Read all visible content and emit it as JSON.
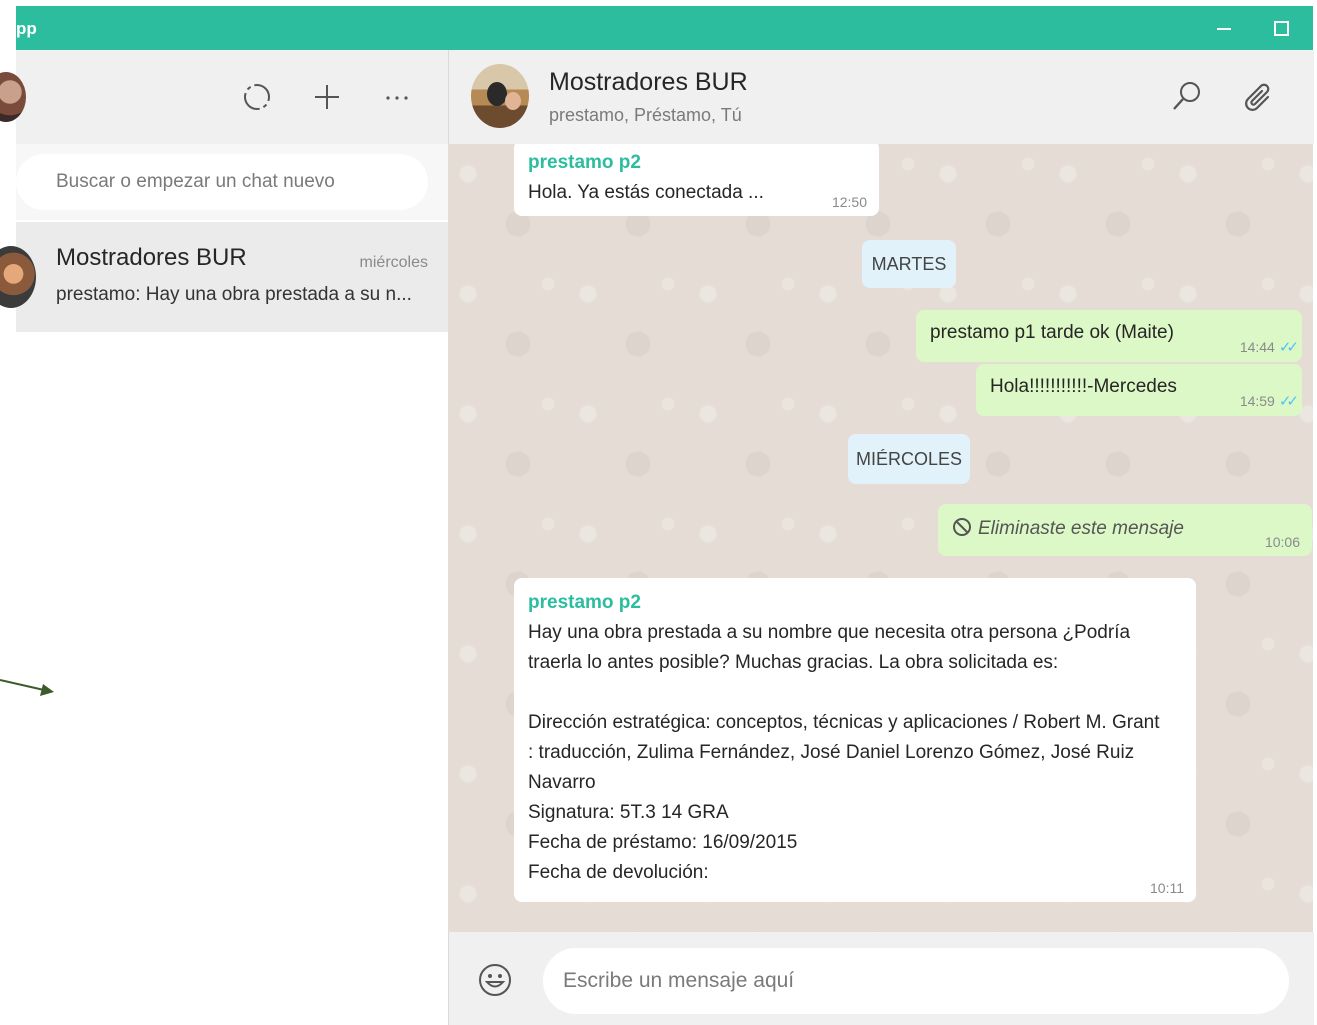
{
  "window": {
    "title": "pp",
    "accent_color": "#2bbd9e"
  },
  "sidebar": {
    "header_icons": [
      "status-icon",
      "new-chat-icon",
      "menu-icon"
    ],
    "search_placeholder": "Buscar o empezar un chat nuevo",
    "chats": [
      {
        "name": "Mostradores BUR",
        "time": "miércoles",
        "preview": "prestamo: Hay una obra prestada a su n..."
      }
    ]
  },
  "chat": {
    "name": "Mostradores BUR",
    "members": "prestamo, Préstamo, Tú",
    "header_icons": [
      "search-icon",
      "attach-icon"
    ],
    "messages": [
      {
        "type": "in",
        "sender": "prestamo p2",
        "text": "Hola. Ya estás conectada ...",
        "time": "12:50"
      },
      {
        "type": "date",
        "text": "MARTES"
      },
      {
        "type": "out",
        "text": "prestamo p1 tarde ok (Maite)",
        "time": "14:44",
        "read": true
      },
      {
        "type": "out",
        "text": "Hola!!!!!!!!!!!-Mercedes",
        "time": "14:59",
        "read": true
      },
      {
        "type": "date",
        "text": "MIÉRCOLES"
      },
      {
        "type": "out-deleted",
        "text": "Eliminaste este mensaje",
        "time": "10:06"
      },
      {
        "type": "in",
        "sender": "prestamo p2",
        "lines": [
          "Hay una obra prestada a su nombre que necesita otra persona ¿Podría",
          "traerla lo antes posible? Muchas gracias. La obra solicitada es:",
          "",
          "Dirección estratégica: conceptos, técnicas y aplicaciones / Robert M. Grant",
          ": traducción, Zulima Fernández, José Daniel Lorenzo Gómez, José Ruiz",
          "Navarro",
          "Signatura: 5T.3 14 GRA",
          "Fecha de préstamo: 16/09/2015",
          "Fecha de devolución:"
        ],
        "time": "10:11"
      }
    ],
    "composer_placeholder": "Escribe un mensaje aquí",
    "tick_color": "#4fc3f7"
  },
  "annotation": {
    "arrow_color": "#3d5a2a"
  }
}
